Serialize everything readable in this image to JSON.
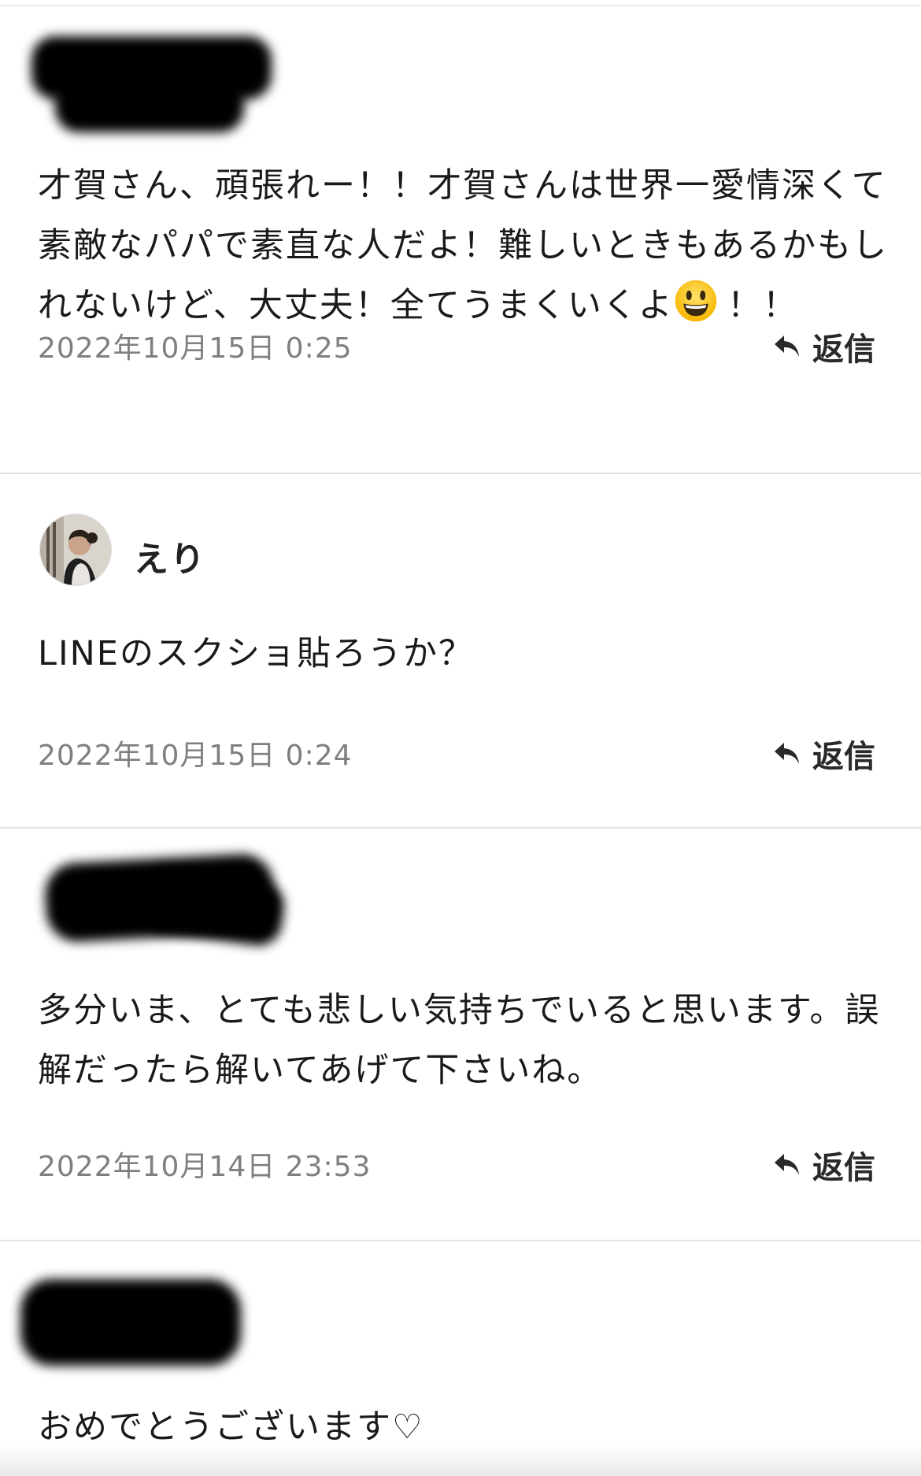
{
  "comments": [
    {
      "username": "",
      "body_parts": [
        "才賀さん、頑張れー！！才賀さんは世界一愛情深くて素敵なパパで素直な人だよ！難しいときもあるかもしれないけど、大丈夫！全てうまくいくよ",
        "！！"
      ],
      "emoji": "grinning-face",
      "timestamp": "2022年10月15日 0:25",
      "reply_label": "返信"
    },
    {
      "username": "えり",
      "body": "LINEのスクショ貼ろうか？",
      "timestamp": "2022年10月15日 0:24",
      "reply_label": "返信"
    },
    {
      "username": "",
      "body": "多分いま、とても悲しい気持ちでいると思います。誤解だったら解いてあげて下さいね。",
      "timestamp": "2022年10月14日 23:53",
      "reply_label": "返信"
    },
    {
      "username": "",
      "body": "おめでとうございます♡"
    }
  ],
  "colors": {
    "timestamp": "#7f7f7f",
    "divider": "#e3e3e3",
    "reply": "#2a2a2a"
  }
}
